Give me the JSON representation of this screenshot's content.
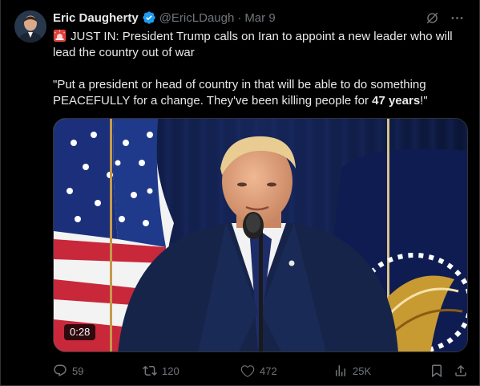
{
  "tweet": {
    "author": {
      "display_name": "Eric Daugherty",
      "handle": "@EricLDaugh",
      "verified": true
    },
    "date": "Mar 9",
    "separator": "·",
    "text": {
      "line1_emoji": "rotating-light-icon",
      "line1": "JUST IN: President Trump calls on Iran to appoint a new leader who will lead the country out of war",
      "quote_start": "\"Put a president or head of country in that will be able to do something PEACEFULLY for a change. They've been killing people for ",
      "quote_bold": "47 years",
      "quote_end": "!\""
    },
    "media": {
      "type": "video",
      "duration": "0:28"
    },
    "actions": {
      "replies": "59",
      "reposts": "120",
      "likes": "472",
      "views": "25K"
    },
    "colors": {
      "background": "#000000",
      "text": "#e7e9ea",
      "secondary": "#71767b",
      "verified": "#1d9bf0"
    }
  }
}
